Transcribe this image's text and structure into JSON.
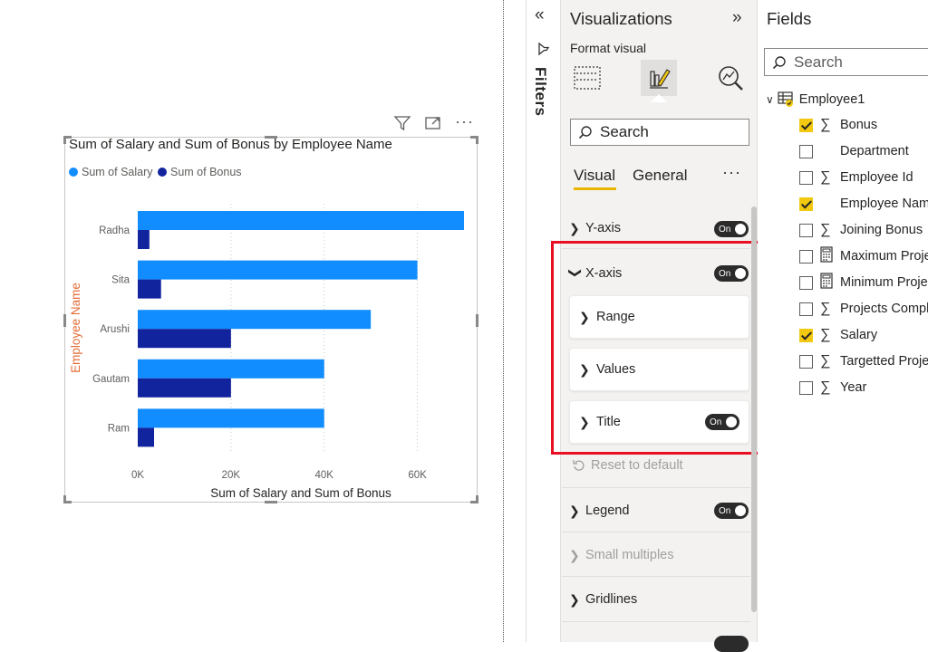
{
  "chart_header": {
    "title": "Sum of Salary and Sum of Bonus by Employee Name",
    "icons": [
      "filter-icon",
      "focus-mode-icon",
      "more-options-icon"
    ]
  },
  "colors": {
    "salary": "#118dff",
    "bonus": "#12239e",
    "axis_title": "#e66c37",
    "highlight": "#e81123",
    "accent_underline": "#e8b600",
    "checkbox_on": "#f2c811"
  },
  "chart_data": {
    "type": "bar",
    "orientation": "horizontal",
    "title": "Sum of Salary and Sum of Bonus by Employee Name",
    "categories": [
      "Radha",
      "Sita",
      "Arushi",
      "Gautam",
      "Ram"
    ],
    "series": [
      {
        "name": "Sum of Salary",
        "values": [
          70000,
          60000,
          50000,
          40000,
          40000
        ]
      },
      {
        "name": "Sum of Bonus",
        "values": [
          2500,
          5000,
          20000,
          20000,
          3500
        ]
      }
    ],
    "xlabel": "Sum of Salary and Sum of Bonus",
    "ylabel": "Employee Name",
    "xlim": [
      0,
      70000
    ],
    "xticks": [
      "0K",
      "20K",
      "40K",
      "60K"
    ],
    "xtick_values": [
      0,
      20000,
      40000,
      60000
    ],
    "grid": "vertical dotted",
    "legend": "top-left"
  },
  "filters": {
    "label": "Filters"
  },
  "visualizations": {
    "title": "Visualizations",
    "format_visual_label": "Format visual",
    "search_placeholder": "Search",
    "tabs": {
      "visual": "Visual",
      "general": "General",
      "more": "···"
    },
    "sections": {
      "y_axis": {
        "label": "Y-axis",
        "toggle": "On"
      },
      "x_axis": {
        "label": "X-axis",
        "toggle": "On"
      },
      "range": {
        "label": "Range"
      },
      "values": {
        "label": "Values"
      },
      "title": {
        "label": "Title",
        "toggle": "On"
      },
      "reset": {
        "label": "Reset to default"
      },
      "legend": {
        "label": "Legend",
        "toggle": "On"
      },
      "small_multiples": {
        "label": "Small multiples"
      },
      "gridlines": {
        "label": "Gridlines"
      }
    }
  },
  "fields": {
    "title": "Fields",
    "search_placeholder": "Search",
    "table": "Employee1",
    "items": [
      {
        "name": "Bonus",
        "type": "sigma",
        "checked": true
      },
      {
        "name": "Department",
        "type": "text",
        "checked": false
      },
      {
        "name": "Employee Id",
        "type": "sigma",
        "checked": false
      },
      {
        "name": "Employee Nam",
        "type": "text",
        "checked": true
      },
      {
        "name": "Joining Bonus",
        "type": "sigma",
        "checked": false
      },
      {
        "name": "Maximum Proje",
        "type": "calc",
        "checked": false
      },
      {
        "name": "Minimum Proje",
        "type": "calc",
        "checked": false
      },
      {
        "name": "Projects Compl",
        "type": "sigma",
        "checked": false
      },
      {
        "name": "Salary",
        "type": "sigma",
        "checked": true
      },
      {
        "name": "Targetted Proje",
        "type": "sigma",
        "checked": false
      },
      {
        "name": "Year",
        "type": "sigma",
        "checked": false
      }
    ]
  }
}
